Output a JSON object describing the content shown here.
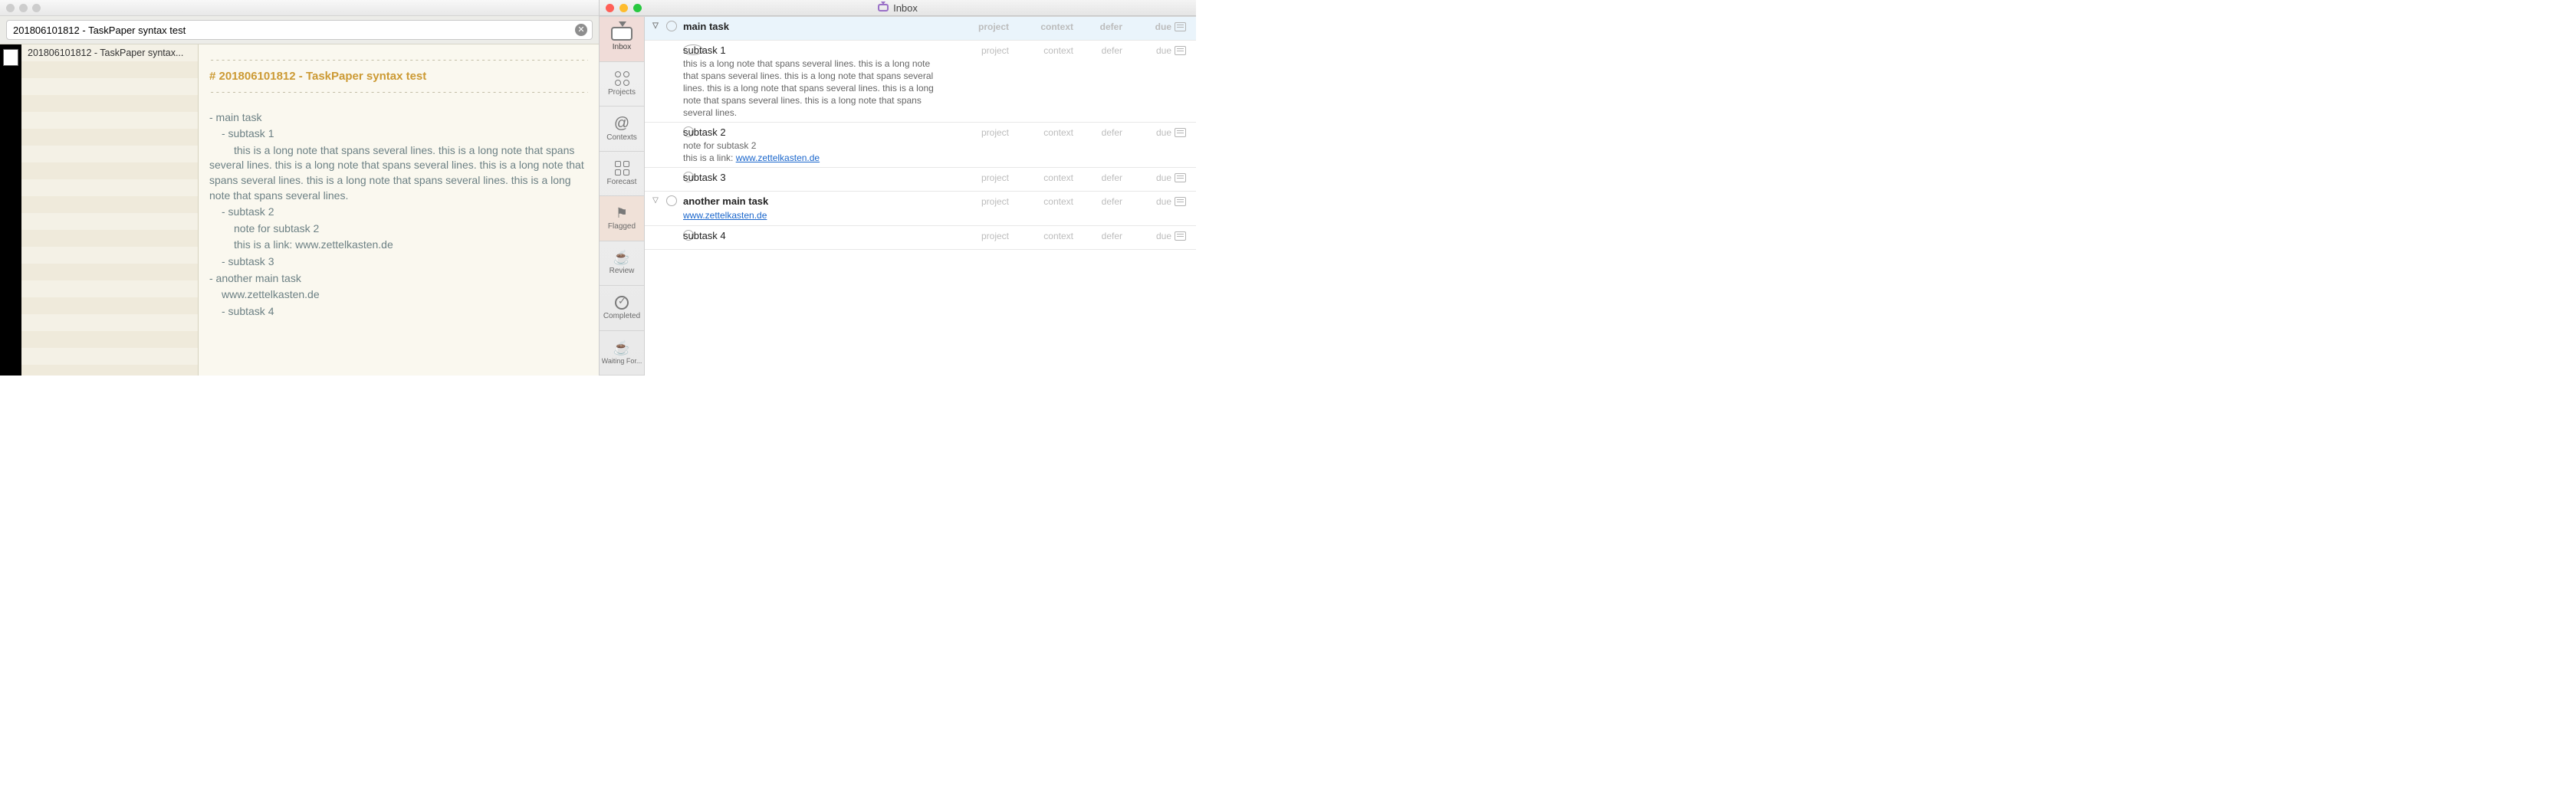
{
  "left_app": {
    "search_value": "201806101812 - TaskPaper syntax test",
    "list_item": "201806101812 - TaskPaper syntax...",
    "rule": "--------------------------------------------------------------------------------------",
    "title": "# 201806101812 - TaskPaper syntax test",
    "body": {
      "l1": "- main task",
      "l2": "- subtask 1",
      "l3": "this is a long note that spans several lines. this is a long note that spans several lines. this is a long note that spans several lines. this is a long note that spans several lines. this is a long note that spans several lines. this is a long note that spans several lines.",
      "l4": "- subtask 2",
      "l5": "note for subtask 2",
      "l6": "this is a link: www.zettelkasten.de",
      "l7": "- subtask 3",
      "l8": "- another main task",
      "l9": "www.zettelkasten.de",
      "l10": "- subtask 4"
    }
  },
  "right_app": {
    "window_title": "Inbox",
    "sidebar": {
      "inbox": "Inbox",
      "projects": "Projects",
      "contexts": "Contexts",
      "forecast": "Forecast",
      "flagged": "Flagged",
      "review": "Review",
      "completed": "Completed",
      "waiting": "Waiting For..."
    },
    "columns": {
      "project": "project",
      "context": "context",
      "defer": "defer",
      "due": "due"
    },
    "rows": [
      {
        "id": "r0",
        "indent": 0,
        "title": "main task",
        "is_parent": true
      },
      {
        "id": "r1",
        "indent": 1,
        "title": "subtask 1",
        "note": "this is a long note that spans several lines. this is a long note that spans several lines. this is a long note that spans several lines. this is a long note that spans several lines. this is a long note that spans several lines. this is a long note that spans several lines."
      },
      {
        "id": "r2",
        "indent": 1,
        "title": "subtask 2",
        "note": "note for subtask 2",
        "note2_pre": "this is a link: ",
        "note2_link": "www.zettelkasten.de"
      },
      {
        "id": "r3",
        "indent": 1,
        "title": "subtask 3"
      },
      {
        "id": "r4",
        "indent": 0,
        "title": "another main task",
        "is_parent": true,
        "link_below": "www.zettelkasten.de"
      },
      {
        "id": "r5",
        "indent": 1,
        "title": "subtask 4"
      }
    ]
  }
}
